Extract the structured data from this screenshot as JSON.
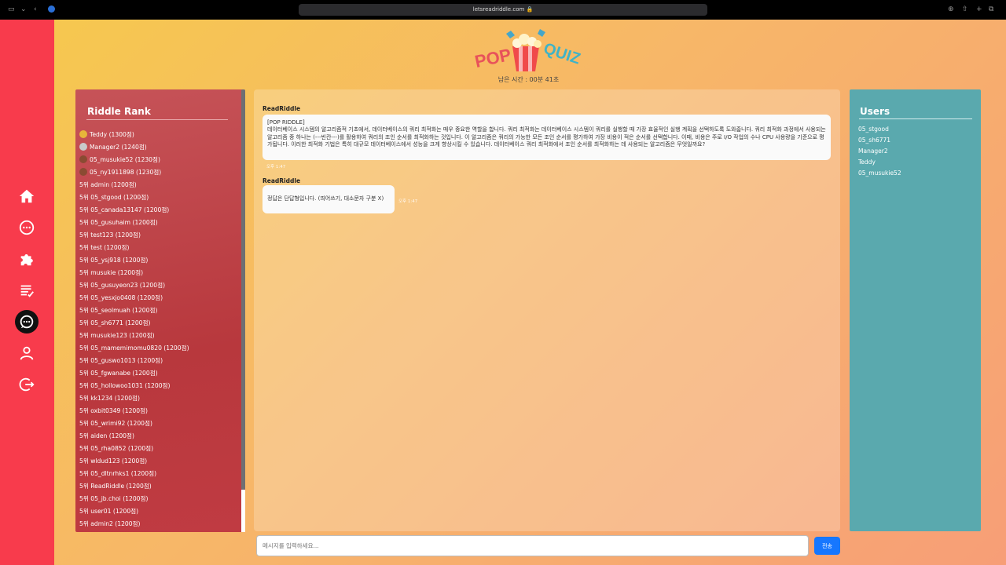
{
  "browser": {
    "url": "letsreadriddle.com"
  },
  "header": {
    "logo_pop": "POP",
    "logo_quiz": "QUIZ",
    "timer": "남은 시간 : 00분 41초"
  },
  "sidebar": {
    "items": [
      {
        "name": "home-icon",
        "active": false
      },
      {
        "name": "chat-bubble-icon",
        "active": false
      },
      {
        "name": "puzzle-icon",
        "active": false
      },
      {
        "name": "checklist-icon",
        "active": false
      },
      {
        "name": "quiz-chat-icon",
        "active": true
      },
      {
        "name": "user-icon",
        "active": false
      },
      {
        "name": "logout-icon",
        "active": false
      }
    ]
  },
  "rank": {
    "title": "Riddle Rank",
    "items": [
      {
        "medal": "gold",
        "label": "Teddy (1300점)"
      },
      {
        "medal": "silver",
        "label": "Manager2 (1240점)"
      },
      {
        "medal": "bronze",
        "label": "05_musukie52 (1230점)"
      },
      {
        "medal": "bronze",
        "label": "05_ny1911898 (1230점)"
      },
      {
        "medal": "",
        "label": "5위 admin (1200점)"
      },
      {
        "medal": "",
        "label": "5위 05_stgood (1200점)"
      },
      {
        "medal": "",
        "label": "5위 05_canada13147 (1200점)"
      },
      {
        "medal": "",
        "label": "5위 05_gusuhaim (1200점)"
      },
      {
        "medal": "",
        "label": "5위 test123 (1200점)"
      },
      {
        "medal": "",
        "label": "5위 test (1200점)"
      },
      {
        "medal": "",
        "label": "5위 05_ysj918 (1200점)"
      },
      {
        "medal": "",
        "label": "5위 musukie (1200점)"
      },
      {
        "medal": "",
        "label": "5위 05_gusuyeon23 (1200점)"
      },
      {
        "medal": "",
        "label": "5위 05_yesxjo0408 (1200점)"
      },
      {
        "medal": "",
        "label": "5위 05_seolmuah (1200점)"
      },
      {
        "medal": "",
        "label": "5위 05_sh6771 (1200점)"
      },
      {
        "medal": "",
        "label": "5위 musukie123 (1200점)"
      },
      {
        "medal": "",
        "label": "5위 05_mamemimomu0820 (1200점)"
      },
      {
        "medal": "",
        "label": "5위 05_guswo1013 (1200점)"
      },
      {
        "medal": "",
        "label": "5위 05_fgwanabe (1200점)"
      },
      {
        "medal": "",
        "label": "5위 05_hollowoo1031 (1200점)"
      },
      {
        "medal": "",
        "label": "5위 kk1234 (1200점)"
      },
      {
        "medal": "",
        "label": "5위 oxbit0349 (1200점)"
      },
      {
        "medal": "",
        "label": "5위 05_wrimi92 (1200점)"
      },
      {
        "medal": "",
        "label": "5위 aiden (1200점)"
      },
      {
        "medal": "",
        "label": "5위 05_rha0852 (1200점)"
      },
      {
        "medal": "",
        "label": "5위 wldud123 (1200점)"
      },
      {
        "medal": "",
        "label": "5위 05_dltnrhks1 (1200점)"
      },
      {
        "medal": "",
        "label": "5위 ReadRiddle (1200점)"
      },
      {
        "medal": "",
        "label": "5위 05_jb.choi (1200점)"
      },
      {
        "medal": "",
        "label": "5위 user01 (1200점)"
      },
      {
        "medal": "",
        "label": "5위 admin2 (1200점)"
      }
    ]
  },
  "chat": {
    "messages": [
      {
        "sender": "ReadRiddle",
        "text_line1": "[POP RIDDLE]",
        "text_body": "데이터베이스 시스템의 알고리즘적 기초에서, 데이터베이스의 쿼리 최적화는 매우 중요한 역할을 합니다. 쿼리 최적화는 데이터베이스 시스템이 쿼리를 실행할 때 가장 효율적인 실행 계획을 선택하도록 도와줍니다. 쿼리 최적화 과정에서 사용되는 알고리즘 중 하나는 (---빈칸---)를 활용하여 쿼리의 조인 순서를 최적화하는 것입니다. 이 알고리즘은 쿼리의 가능한 모든 조인 순서를 평가하여 가장 비용이 적은 순서를 선택합니다. 이때, 비용은 주로 I/O 작업의 수나 CPU 사용량을 기준으로 평가됩니다. 이러한 최적화 기법은 특히 대규모 데이터베이스에서 성능을 크게 향상시킬 수 있습니다. 데이터베이스 쿼리 최적화에서 조인 순서를 최적화하는 데 사용되는 알고리즘은 무엇일까요?",
        "time": "오후 1:47"
      },
      {
        "sender": "ReadRiddle",
        "text_body": "정답은 단답형입니다. (띄어쓰기, 대소문자 구분 X)",
        "time": "오후 1:47"
      }
    ],
    "input_placeholder": "메시지를 입력하세요...",
    "send_label": "전송"
  },
  "users": {
    "title": "Users",
    "items": [
      "05_stgood",
      "05_sh6771",
      "Manager2",
      "Teddy",
      "05_musukie52"
    ]
  },
  "colors": {
    "sidebar": "#f83b4c",
    "rank_panel": "#b8383d",
    "users_panel": "#5aa9ae",
    "send_button": "#1677ff"
  }
}
